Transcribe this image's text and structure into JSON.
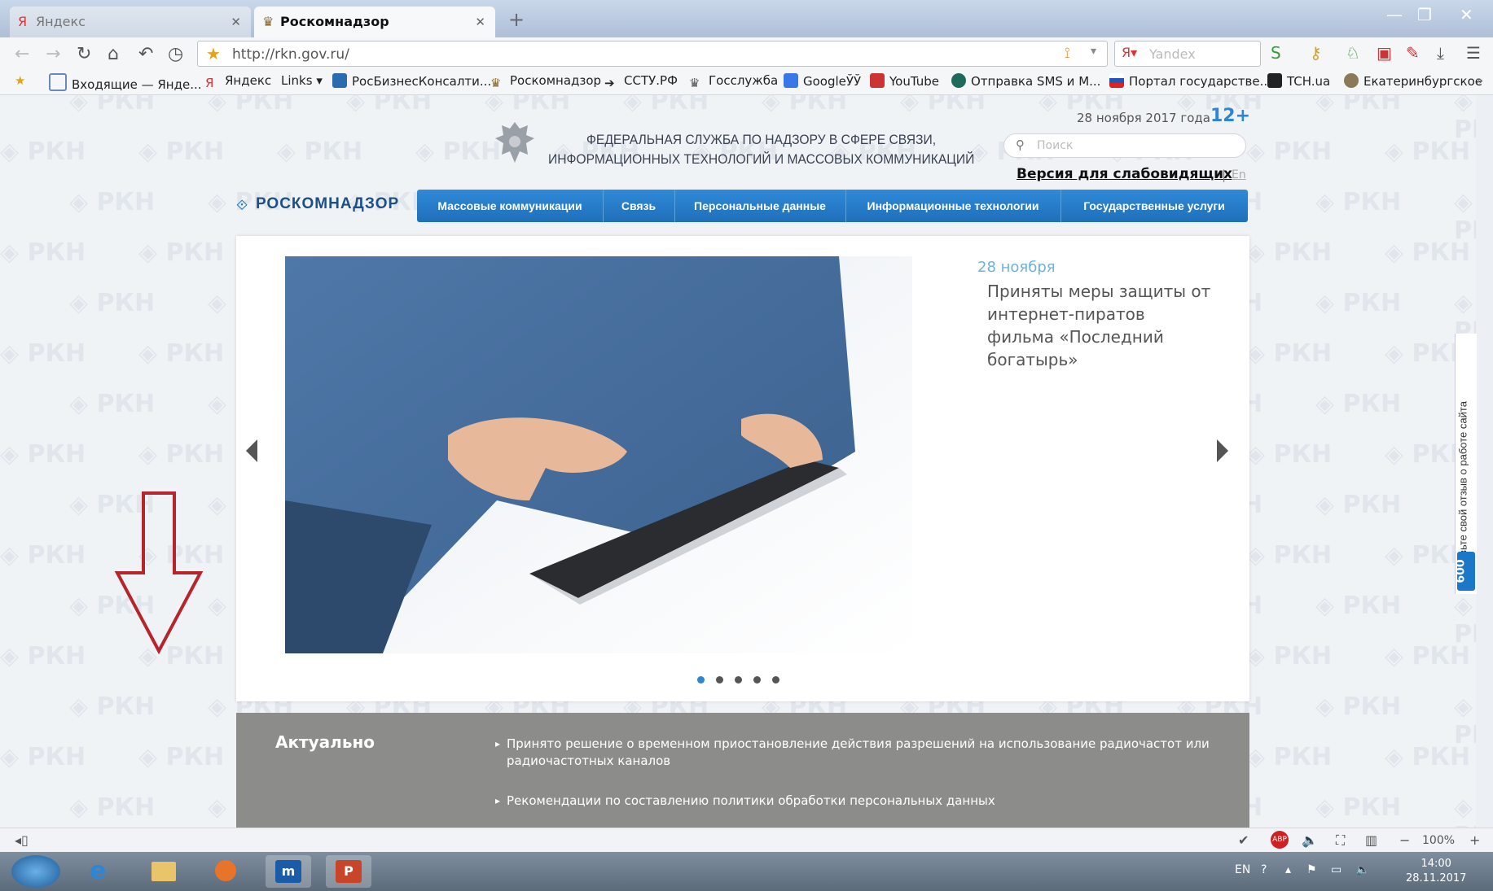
{
  "browser": {
    "tabs": [
      {
        "label": "Яндекс",
        "active": false
      },
      {
        "label": "Роскомнадзор",
        "active": true
      }
    ],
    "url": "http://rkn.gov.ru/",
    "search_placeholder": "Yandex",
    "bookmarks": [
      "Входящие — Янде...",
      "Яндекс",
      "Links",
      "РосБизнесКонсалти...",
      "Роскомнадзор",
      "ССТУ.РФ",
      "Госслужба",
      "GoogleЎЎ",
      "YouTube",
      "Отправка SMS и М...",
      "Портал государстве...",
      "TCH.ua",
      "Екатеринбургское"
    ]
  },
  "site": {
    "agency_line1": "ФЕДЕРАЛЬНАЯ СЛУЖБА ПО НАДЗОРУ В СФЕРЕ СВЯЗИ,",
    "agency_line2": "ИНФОРМАЦИОННЫХ ТЕХНОЛОГИЙ И МАССОВЫХ КОММУНИКАЦИЙ",
    "date": "28 ноября 2017 года",
    "age_rating": "12+",
    "search_placeholder": "Поиск",
    "accessible_version": "Версия для слабовидящих",
    "lang_sep": "|",
    "lang_en": "En",
    "logo": "РОСКОМНАДЗОР",
    "menu": [
      "Массовые коммуникации",
      "Связь",
      "Персональные данные",
      "Информационные технологии",
      "Государственные услуги"
    ],
    "watermark": "РКН",
    "feedback_text": "Оставьте свой отзыв о работе сайта",
    "feedback_badge": "600"
  },
  "slider": {
    "date": "28 ноября",
    "title": "Приняты меры защиты от интернет-пиратов фильма «Последний богатырь»",
    "dots_total": 5,
    "active_dot": 1
  },
  "actual": {
    "heading": "Актуально",
    "items": [
      "Принято решение о временном приостановление действия разрешений на использование радиочастот или радиочастотных каналов",
      "Рекомендации по составлению политики обработки персональных данных"
    ]
  },
  "statusbar": {
    "zoom": "100%"
  },
  "taskbar": {
    "lang": "EN",
    "time": "14:00",
    "date": "28.11.2017"
  },
  "colors": {
    "menu_blue": "#1f6fb9",
    "accent_blue": "#2d86d3",
    "actual_bg": "#8c8d8b",
    "arrow_red": "#b5262c"
  }
}
